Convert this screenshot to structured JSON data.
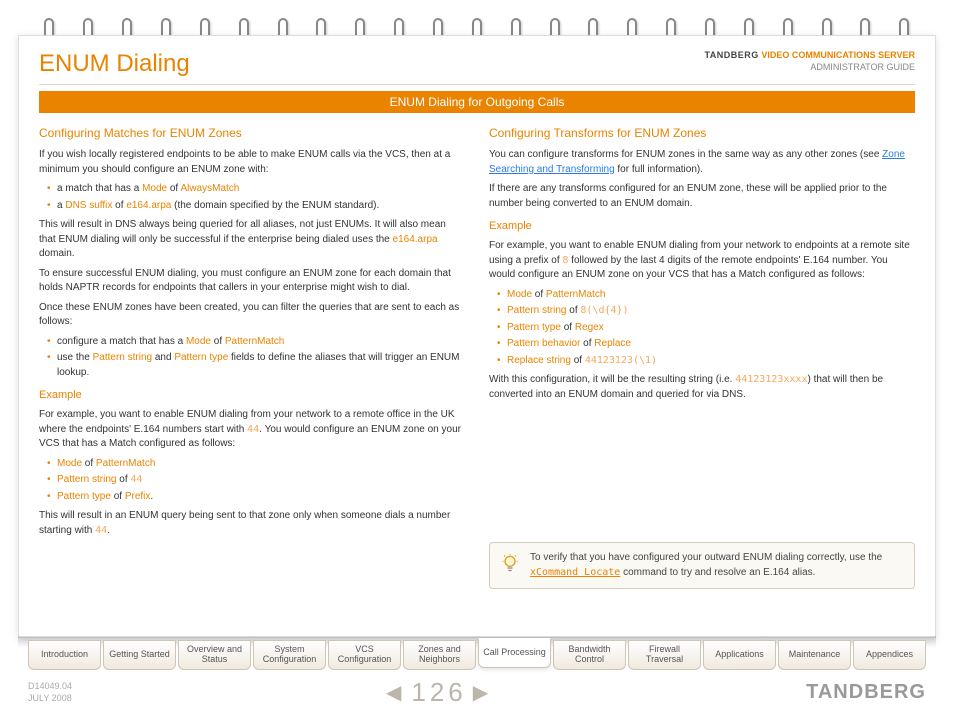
{
  "header": {
    "title": "ENUM Dialing",
    "brand_name": "TANDBERG",
    "brand_product": "VIDEO COMMUNICATIONS SERVER",
    "brand_sub": "ADMINISTRATOR GUIDE"
  },
  "section_bar": "ENUM Dialing for Outgoing Calls",
  "left": {
    "h1": "Configuring Matches for ENUM Zones",
    "p1": "If you wish locally registered endpoints to be able to make ENUM calls via the VCS, then at a minimum you should configure an ENUM zone with:",
    "li1a": "a match that has a ",
    "li1_mode": "Mode",
    "li1_of": " of ",
    "li1_val": "AlwaysMatch",
    "li2a": "a ",
    "li2_dns": "DNS suffix",
    "li2_of": " of ",
    "li2_val": "e164.arpa",
    "li2_end": " (the domain specified by the ENUM standard).",
    "p2a": "This will result in DNS always being queried for all aliases, not just ENUMs. It will also mean that ENUM dialing will only be successful if the enterprise being dialed uses the ",
    "p2_dom": "e164.arpa",
    "p2b": " domain.",
    "p3": "To ensure successful ENUM dialing, you must configure an ENUM zone for each domain that holds NAPTR records for endpoints that callers in your enterprise might wish to dial.",
    "p4": "Once these ENUM zones have been created, you can filter the queries that are sent to each as follows:",
    "li3a": "configure a match that has a ",
    "li3_mode": "Mode",
    "li3_of": " of ",
    "li3_val": "PatternMatch",
    "li4a": "use the ",
    "li4_ps": "Pattern string",
    "li4_and": " and ",
    "li4_pt": "Pattern type",
    "li4_end": " fields to define the aliases that will trigger an ENUM lookup.",
    "ex_h": "Example",
    "ex_p1a": "For example, you want to enable ENUM dialing from your network to a remote office in the UK where the endpoints' E.164 numbers start with ",
    "ex_v1": "44",
    "ex_p1b": ". You would configure an ENUM zone on your VCS that has a Match configured as follows:",
    "exli1_a": "Mode",
    "exli1_of": " of ",
    "exli1_b": "PatternMatch",
    "exli2_a": "Pattern string",
    "exli2_of": " of ",
    "exli2_b": "44",
    "exli3_a": "Pattern type",
    "exli3_of": " of ",
    "exli3_b": "Prefix",
    "exli3_dot": ".",
    "ex_p2a": "This will result in an ENUM query being sent to that zone only when someone dials a number starting with ",
    "ex_p2v": "44",
    "ex_p2b": "."
  },
  "right": {
    "h1": "Configuring Transforms for ENUM Zones",
    "p1a": "You can configure transforms for ENUM zones in the same way as any other zones (see ",
    "p1_link": "Zone Searching and Transforming",
    "p1b": " for full information).",
    "p2": "If there are any transforms configured for an ENUM zone, these will be applied prior to the number being converted to an ENUM domain.",
    "ex_h": "Example",
    "ex_p1a": "For example, you want to enable ENUM dialing from your network to endpoints at a remote site using a prefix of ",
    "ex_v1": "8",
    "ex_p1b": " followed by the last 4 digits of the remote endpoints' E.164 number.  You would configure an ENUM zone on your VCS that has a Match configured as follows:",
    "li1_a": "Mode",
    "li1_of": " of ",
    "li1_b": "PatternMatch",
    "li2_a": "Pattern string",
    "li2_of": " of ",
    "li2_b": "8(\\d{4})",
    "li3_a": "Pattern type",
    "li3_of": " of ",
    "li3_b": "Regex",
    "li4_a": "Pattern behavior",
    "li4_of": " of ",
    "li4_b": "Replace",
    "li5_a": "Replace string",
    "li5_of": " of ",
    "li5_b": "44123123(\\1)",
    "p3a": "With this configuration, it will be the resulting string (i.e. ",
    "p3v": "44123123xxxx",
    "p3b": ") that will then be converted into an ENUM domain and queried for via DNS.",
    "tip_a": "To verify that you have configured your outward ENUM dialing correctly, use the ",
    "tip_cmd": "xCommand Locate",
    "tip_b": " command to try and resolve an E.164 alias."
  },
  "tabs": [
    "Introduction",
    "Getting Started",
    "Overview and Status",
    "System Configuration",
    "VCS Configuration",
    "Zones and Neighbors",
    "Call Processing",
    "Bandwidth Control",
    "Firewall Traversal",
    "Applications",
    "Maintenance",
    "Appendices"
  ],
  "active_tab_index": 6,
  "footer": {
    "doc_id": "D14049.04",
    "doc_date": "JULY 2008",
    "page": "126",
    "logo": "TANDBERG"
  }
}
